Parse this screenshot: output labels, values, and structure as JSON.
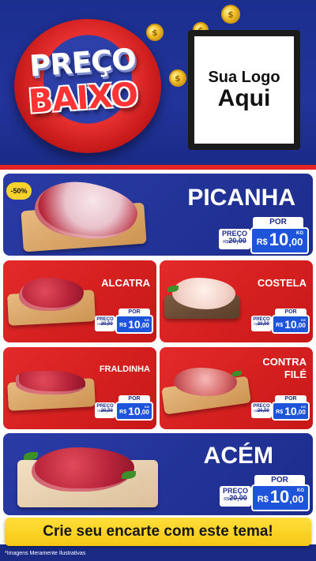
{
  "header": {
    "badge_line_1": "PREÇO",
    "badge_line_2": "BAIXO",
    "logo_line_1": "Sua Logo",
    "logo_line_2": "Aqui",
    "coin_symbol": "$"
  },
  "discount_badge": "-50%",
  "price_labels": {
    "por": "POR",
    "preco": "PREÇO",
    "currency": "R$",
    "unit": "KG"
  },
  "products": [
    {
      "name": "PICANHA",
      "old_price": "20,00",
      "price_int": "10",
      "price_dec": ",00"
    },
    {
      "name": "ALCATRA",
      "old_price": "20,00",
      "price_int": "10",
      "price_dec": ",00"
    },
    {
      "name": "COSTELA",
      "old_price": "20,00",
      "price_int": "10",
      "price_dec": ",00"
    },
    {
      "name": "FRALDINHA",
      "old_price": "20,00",
      "price_int": "10",
      "price_dec": ",00"
    },
    {
      "name_line_1": "CONTRA",
      "name_line_2": "FILÉ",
      "old_price": "20,00",
      "price_int": "10",
      "price_dec": ",00"
    },
    {
      "name": "ACÉM",
      "old_price": "20,00",
      "price_int": "10",
      "price_dec": ",00"
    }
  ],
  "cta_text": "Crie seu encarte com este tema!",
  "disclaimer": "*Imagens Meramente Ilustrativas",
  "colors": {
    "brand_blue": "#1c2c8c",
    "brand_red": "#e42a2a",
    "price_blue": "#1e54d9",
    "cta_yellow": "#f6c814"
  }
}
